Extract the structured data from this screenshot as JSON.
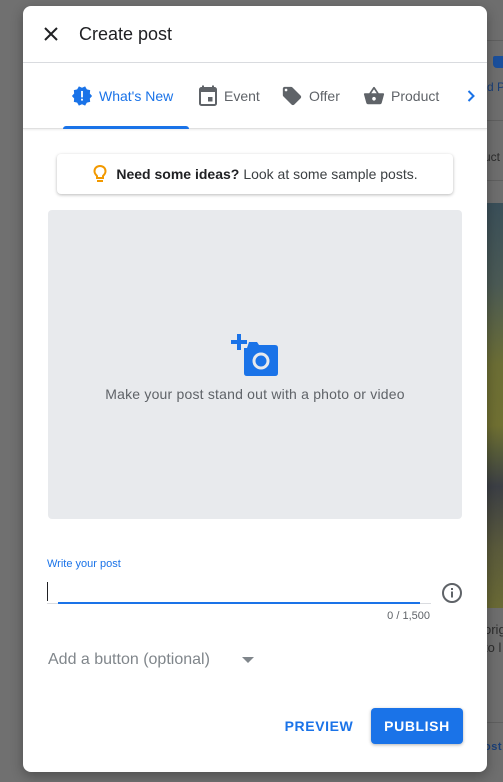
{
  "background": {
    "tab_fragment": "d P",
    "text_fragment_1": "uct",
    "text_fragment_2": "orig",
    "text_fragment_3": "to l",
    "link_fragment": "ost"
  },
  "dialog": {
    "title": "Create post",
    "close_icon": "close-icon",
    "tabs": [
      {
        "label": "What's New",
        "icon": "new-releases-icon",
        "active": true
      },
      {
        "label": "Event",
        "icon": "calendar-icon",
        "active": false
      },
      {
        "label": "Offer",
        "icon": "tag-icon",
        "active": false
      },
      {
        "label": "Product",
        "icon": "basket-icon",
        "active": false
      }
    ],
    "tabs_next_icon": "chevron-right-icon",
    "ideas": {
      "bold": "Need some ideas?",
      "text": "Look at some sample posts.",
      "icon": "lightbulb-icon",
      "icon_color": "#f29900"
    },
    "photo": {
      "text": "Make your post stand out with a photo or video",
      "icon": "add-photo-icon"
    },
    "post_field": {
      "label": "Write your post",
      "value": "",
      "counter": "0 / 1,500",
      "info_icon": "info-icon"
    },
    "button_dropdown": {
      "placeholder": "Add a button (optional)"
    },
    "actions": {
      "preview": "PREVIEW",
      "publish": "PUBLISH"
    }
  },
  "colors": {
    "accent": "#1a73e8",
    "overlay": "#707070",
    "photo_bg": "#e8eaed"
  }
}
